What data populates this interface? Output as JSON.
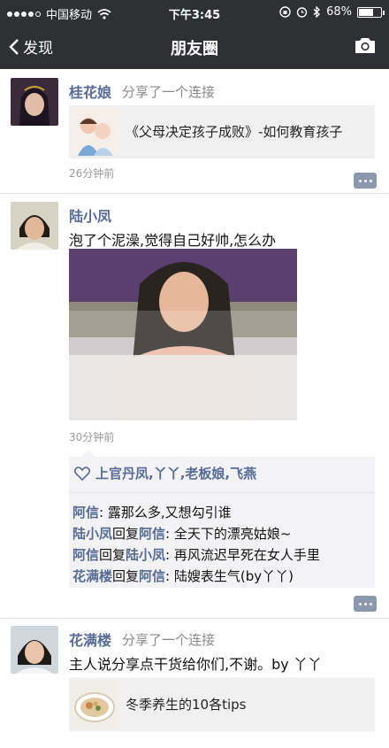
{
  "status": {
    "carrier": "中国移动",
    "time": "下午3:45",
    "battery": "68%",
    "battery_level": 0.68
  },
  "nav": {
    "back_label": "发现",
    "title": "朋友圈"
  },
  "posts": [
    {
      "author": "桂花娘",
      "action": "分享了一个连接",
      "link_title": "《父母决定孩子成败》-如何教育孩子",
      "time": "26分钟前"
    },
    {
      "author": "陆小凤",
      "text": "泡了个泥澡,觉得自己好帅,怎么办",
      "time": "30分钟前",
      "likes": "上官丹凤,丫丫,老板娘,飞燕",
      "comments": [
        {
          "from": "阿信",
          "to": "",
          "text": "露那么多,又想勾引谁"
        },
        {
          "from": "陆小凤",
          "to": "阿信",
          "text": "全天下的漂亮姑娘~"
        },
        {
          "from": "阿信",
          "to": "陆小凤",
          "text": "再风流迟早死在女人手里"
        },
        {
          "from": "花满楼",
          "to": "阿信",
          "text": "陆嫂表生气(by丫丫)"
        }
      ]
    },
    {
      "author": "花满楼",
      "action": "分享了一个连接",
      "text": "主人说分享点干货给你们,不谢。by 丫丫",
      "link_title": "冬季养生的10各tips"
    }
  ],
  "labels": {
    "reply": "回复",
    "colon": ":"
  },
  "colors": {
    "bar": "#2e3033",
    "name": "#576b95",
    "card": "#f0f0f0"
  }
}
